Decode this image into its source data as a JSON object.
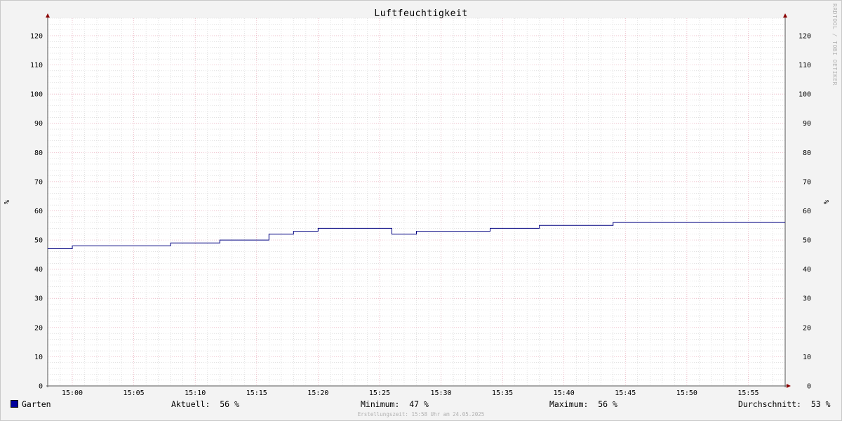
{
  "chart_data": {
    "type": "line",
    "title": "Luftfeuchtigkeit",
    "ylabel": "%",
    "ylim": [
      0,
      126
    ],
    "y_ticks": [
      0,
      10,
      20,
      30,
      40,
      50,
      60,
      70,
      80,
      90,
      100,
      110,
      120
    ],
    "x_tick_labels": [
      "15:00",
      "15:05",
      "15:10",
      "15:15",
      "15:20",
      "15:25",
      "15:30",
      "15:35",
      "15:40",
      "15:45",
      "15:50",
      "15:55"
    ],
    "x_range": [
      "14:58",
      "15:58"
    ],
    "grid": true,
    "series": [
      {
        "name": "Garten",
        "color": "#000080",
        "step": true,
        "points": [
          {
            "x": "14:58",
            "y": 47
          },
          {
            "x": "15:00",
            "y": 48
          },
          {
            "x": "15:08",
            "y": 49
          },
          {
            "x": "15:12",
            "y": 50
          },
          {
            "x": "15:16",
            "y": 52
          },
          {
            "x": "15:18",
            "y": 53
          },
          {
            "x": "15:20",
            "y": 54
          },
          {
            "x": "15:26",
            "y": 52
          },
          {
            "x": "15:28",
            "y": 53
          },
          {
            "x": "15:34",
            "y": 54
          },
          {
            "x": "15:38",
            "y": 55
          },
          {
            "x": "15:44",
            "y": 56
          },
          {
            "x": "15:58",
            "y": 56
          }
        ]
      }
    ]
  },
  "watermark": "RRDTOOL / TOBI OETIKER",
  "legend": {
    "series_name": "Garten",
    "swatch_color": "#00009c",
    "stats": {
      "current": "Aktuell:  56 %",
      "minimum": "Minimum:  47 %",
      "maximum": "Maximum:  56 %",
      "average": "Durchschnitt:  53 %"
    }
  },
  "footer": "Erstellungszeit: 15:58 Uhr am 24.05.2025"
}
